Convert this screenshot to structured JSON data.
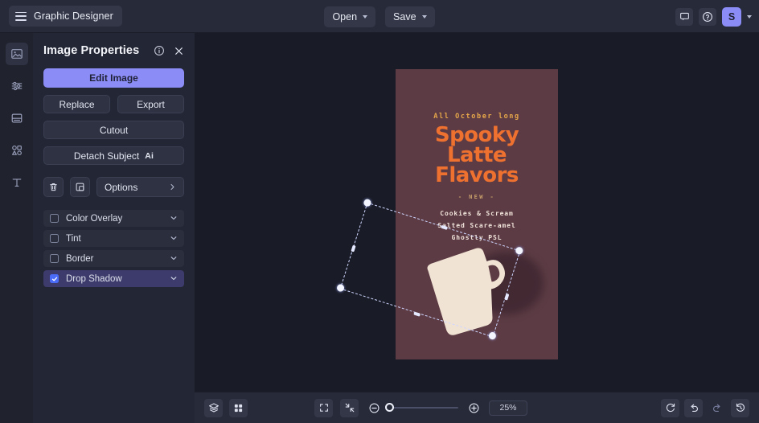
{
  "topbar": {
    "menu_icon": "hamburger-icon",
    "app_name": "Graphic Designer",
    "open_label": "Open",
    "save_label": "Save",
    "comment_icon": "comment-icon",
    "help_icon": "help-circle-icon",
    "avatar_initial": "S",
    "accent_color": "#8c8cf7"
  },
  "rail": {
    "items": [
      {
        "name": "image-tool",
        "icon": "image-icon",
        "active": true
      },
      {
        "name": "adjust-tool",
        "icon": "sliders-icon",
        "active": false
      },
      {
        "name": "layout-tool",
        "icon": "layout-icon",
        "active": false
      },
      {
        "name": "elements-tool",
        "icon": "shapes-icon",
        "active": false
      },
      {
        "name": "text-tool",
        "icon": "text-icon",
        "active": false
      }
    ]
  },
  "panel": {
    "title": "Image Properties",
    "info_icon": "info-circle-icon",
    "close_icon": "close-icon",
    "edit_image_label": "Edit Image",
    "replace_label": "Replace",
    "export_label": "Export",
    "cutout_label": "Cutout",
    "detach_subject_label": "Detach Subject",
    "detach_subject_badge": "Ai",
    "delete_icon": "trash-icon",
    "duplicate_icon": "duplicate-icon",
    "options_label": "Options",
    "effects": [
      {
        "label": "Color Overlay",
        "checked": false
      },
      {
        "label": "Tint",
        "checked": false
      },
      {
        "label": "Border",
        "checked": false
      },
      {
        "label": "Drop Shadow",
        "checked": true
      }
    ]
  },
  "canvas": {
    "background_color": "#191b26",
    "poster": {
      "background_color": "#5c3b44",
      "kicker": "All October long",
      "title_line1": "Spooky",
      "title_line2": "Latte",
      "title_line3": "Flavors",
      "title_color": "#ef7130",
      "new_label": "- NEW -",
      "flavor1": "Cookies & Scream",
      "flavor2": "Salted Scare-amel",
      "flavor3": "Ghostly PSL"
    },
    "selection": {
      "object_name": "mug-cutout",
      "rotation_deg": 17.5
    }
  },
  "bottombar": {
    "layers_icon": "layers-icon",
    "grid_icon": "grid-icon",
    "fit-frame_icon": "fit-frame-icon",
    "fit-content_icon": "fit-content-icon",
    "zoom_out_icon": "zoom-out-icon",
    "zoom_in_icon": "zoom-in-icon",
    "zoom_value": "25%",
    "reset_icon": "reset-icon",
    "undo_icon": "undo-icon",
    "redo_icon": "redo-icon",
    "history_icon": "history-icon"
  }
}
